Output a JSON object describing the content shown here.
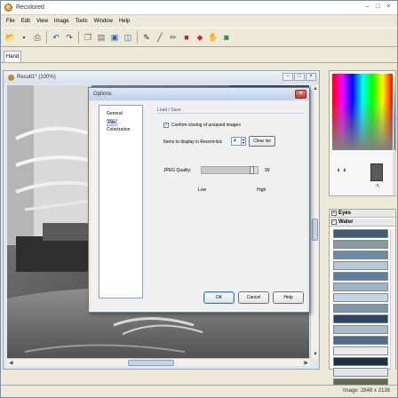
{
  "app": {
    "title": "Recolored",
    "menu": [
      "File",
      "Edit",
      "View",
      "Image",
      "Tools",
      "Window",
      "Help"
    ],
    "toolbar_icons": [
      "open-icon",
      "save-icon",
      "print-icon",
      "undo-icon",
      "redo-icon",
      "copy-icon",
      "paste-icon",
      "view-icon",
      "split-icon",
      "pen-icon",
      "brush-icon",
      "pencil-icon",
      "color-icon",
      "eraser-icon",
      "hand-icon",
      "stamp-icon"
    ],
    "active_tool_tab": "Hand",
    "window_controls": {
      "minimize": "–",
      "maximize": "□",
      "close": "×"
    }
  },
  "document": {
    "title": "Result1* (100%)",
    "controls": {
      "minimize": "–",
      "maximize": "□",
      "close": "×"
    }
  },
  "options_dialog": {
    "title": "Options",
    "close": "×",
    "categories": [
      "General",
      "File",
      "Colorization"
    ],
    "selected_category": "File",
    "section_title": "Load / Save",
    "confirm_closing_label": "Confirm closing of unsaved images",
    "confirm_closing_checked": true,
    "recent_label": "Items to display in Recent-list:",
    "recent_value": "4",
    "clear_button": "Clear list",
    "jpeg_label": "JPEG Quality:",
    "jpeg_quality": 90,
    "jpeg_value_label": "90",
    "low_label": "Low",
    "high_label": "High",
    "buttons": {
      "ok": "OK",
      "cancel": "Cancel",
      "help": "Help"
    }
  },
  "palette": {
    "groups": [
      {
        "name": "Eyes",
        "expanded": false
      },
      {
        "name": "Water",
        "expanded": true
      }
    ],
    "swatch_colors": [
      "#3f5a73",
      "#8a9aa5",
      "#6b8aa4",
      "#b8c7d6",
      "#5f7f98",
      "#9fb3c6",
      "#c4d6e8",
      "#7e97ab",
      "#2d4560",
      "#a9bbca",
      "#4d6d8a",
      "#e8ecef",
      "#1a3044",
      "#dfe6ea",
      "#5c6e58",
      "#f4f6f2"
    ]
  },
  "status": {
    "image_size": "Image: 2848 x 2136"
  }
}
